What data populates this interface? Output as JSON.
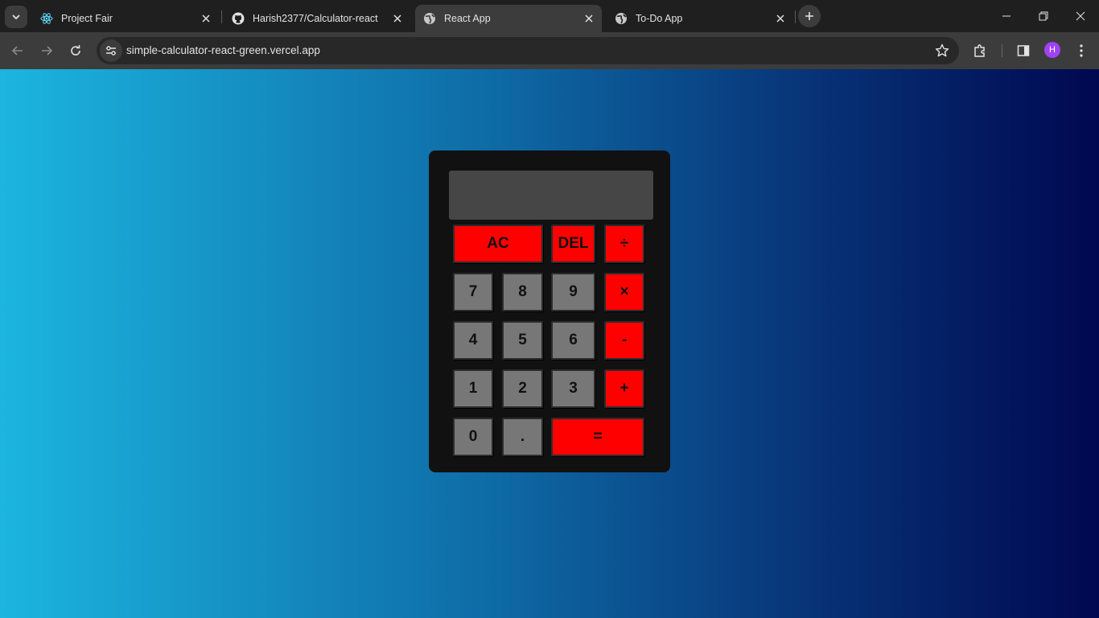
{
  "browser": {
    "tabs": [
      {
        "title": "Project Fair",
        "icon": "react-icon",
        "active": false
      },
      {
        "title": "Harish2377/Calculator-react",
        "icon": "github-icon",
        "active": false
      },
      {
        "title": "React App",
        "icon": "globe-icon",
        "active": true
      },
      {
        "title": "To-Do App",
        "icon": "globe-icon",
        "active": false
      }
    ],
    "url": "simple-calculator-react-green.vercel.app",
    "profile_initial": "H"
  },
  "calculator": {
    "display_value": "",
    "keys": {
      "ac": "AC",
      "del": "DEL",
      "divide": "÷",
      "seven": "7",
      "eight": "8",
      "nine": "9",
      "multiply": "×",
      "four": "4",
      "five": "5",
      "six": "6",
      "minus": "-",
      "one": "1",
      "two": "2",
      "three": "3",
      "plus": "+",
      "zero": "0",
      "dot": ".",
      "equals": "="
    }
  },
  "colors": {
    "operator_key": "#ff0000",
    "number_key": "#777777",
    "calculator_body": "#111111",
    "display": "#464646",
    "gradient_start": "#1cb5e0",
    "gradient_end": "#000851"
  }
}
